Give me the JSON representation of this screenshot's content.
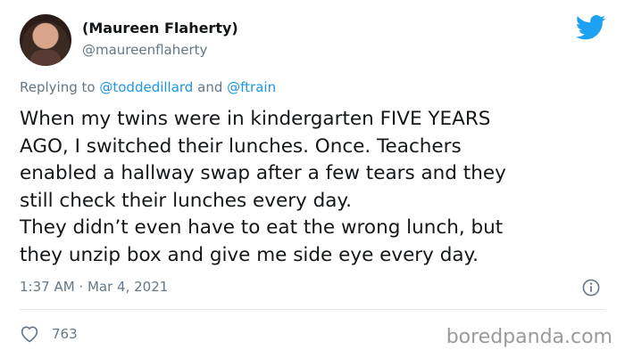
{
  "author": {
    "name": "(Maureen Flaherty)",
    "handle": "@maureenflaherty"
  },
  "reply": {
    "prefix": "Replying to",
    "user1": "@toddedillard",
    "connector": "and",
    "user2": "@ftrain"
  },
  "tweet": {
    "text": "When my twins were in kindergarten FIVE YEARS\nAGO, I switched their lunches. Once. Teachers\nenabled a hallway swap after a few tears and they\nstill check their lunches every day.\nThey didn’t even have to eat the wrong lunch, but\nthey unzip box and give me side eye every day.",
    "timestamp": "1:37 AM · Mar 4, 2021"
  },
  "engagement": {
    "likes": "763"
  },
  "watermark": "boredpanda.com",
  "icons": {
    "brand": "twitter-bird-icon",
    "info": "info-icon",
    "like": "heart-outline-icon"
  },
  "colors": {
    "twitter_blue": "#1da1f2",
    "link_blue": "#1b95e0",
    "muted": "#657786"
  }
}
